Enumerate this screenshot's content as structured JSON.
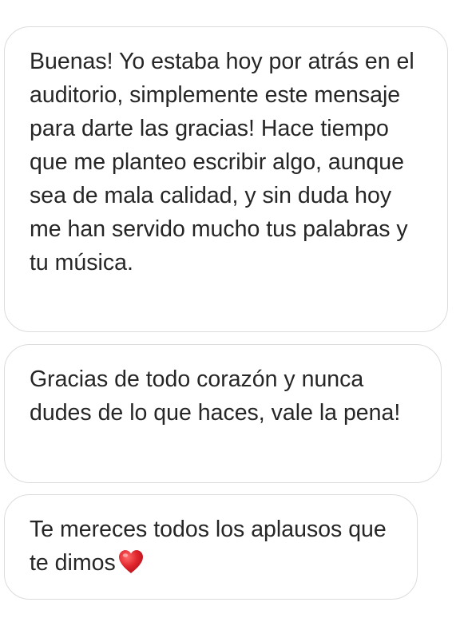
{
  "messages": [
    {
      "text": "Buenas! Yo estaba hoy por atrás en el auditorio, simplemente este mensaje para darte las gracias! Hace tiempo que me planteo escribir algo, aunque sea de mala calidad, y sin duda hoy me han servido mucho tus palabras y tu música."
    },
    {
      "text": "Gracias de todo corazón y nunca dudes de lo que haces, vale la pena!"
    },
    {
      "text": "Te mereces todos los aplausos que te dimos",
      "trailing_icon": "red-heart-icon"
    }
  ],
  "colors": {
    "text": "#262626",
    "bubble_border": "#dcdcdc",
    "background": "#ffffff",
    "heart": "#e0242c"
  }
}
